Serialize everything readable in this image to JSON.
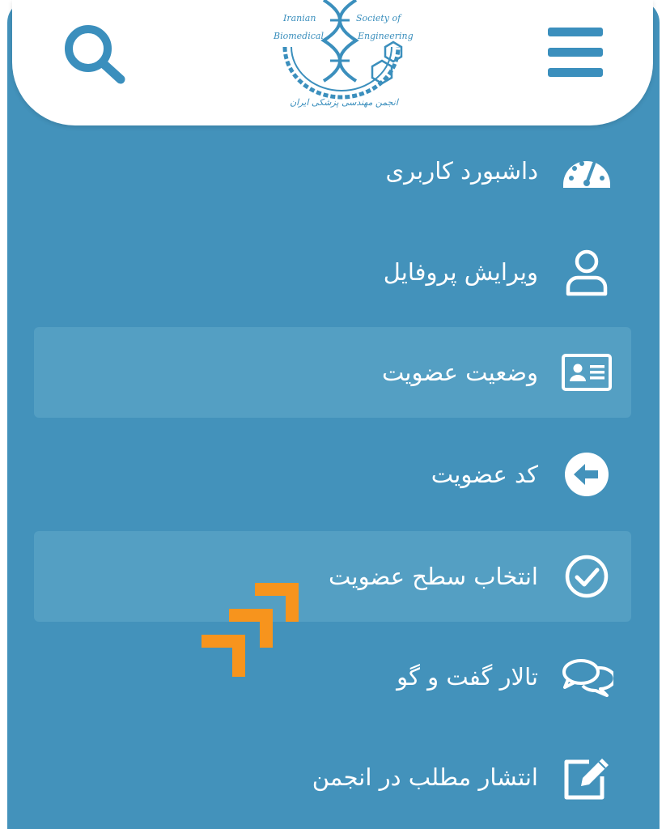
{
  "header": {
    "search_icon": "search-icon",
    "menu_icon": "hamburger-menu-icon",
    "logo": {
      "line1_left": "Iranian",
      "line1_right": "Society of",
      "line2_left": "Biomedical",
      "line2_right": "Engineering",
      "persian": "انجمن مهندسی پزشکی ایران"
    }
  },
  "menu": {
    "items": [
      {
        "label": "داشبورد کاربری",
        "icon": "dashboard-gauge-icon",
        "highlighted": false
      },
      {
        "label": "ویرایش پروفایل",
        "icon": "user-profile-icon",
        "highlighted": false
      },
      {
        "label": "وضعیت عضویت",
        "icon": "id-card-icon",
        "highlighted": true
      },
      {
        "label": "کد عضویت",
        "icon": "arrow-left-circle-icon",
        "highlighted": false
      },
      {
        "label": "انتخاب سطح عضویت",
        "icon": "check-circle-icon",
        "highlighted": true
      },
      {
        "label": "تالار گفت و گو",
        "icon": "comments-icon",
        "highlighted": false
      },
      {
        "label": "انتشار مطلب در انجمن",
        "icon": "edit-post-icon",
        "highlighted": false
      }
    ]
  },
  "overlay": {
    "icon": "orange-double-arrow-icon"
  },
  "colors": {
    "panel": "#4392bb",
    "highlight": "#549fc3",
    "accent": "#3b8fbd",
    "arrow": "#f7941d"
  }
}
